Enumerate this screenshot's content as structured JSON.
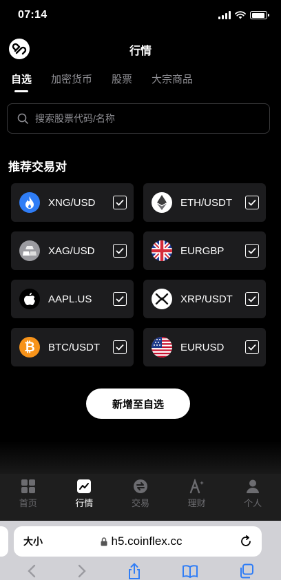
{
  "status_bar": {
    "time": "07:14",
    "battery_level": 0.9
  },
  "header": {
    "title": "行情",
    "logo_icon": "coinflex-logo"
  },
  "tabs": [
    {
      "label": "自选",
      "active": true
    },
    {
      "label": "加密货币",
      "active": false
    },
    {
      "label": "股票",
      "active": false
    },
    {
      "label": "大宗商品",
      "active": false
    }
  ],
  "search": {
    "placeholder": "搜索股票代码/名称"
  },
  "section": {
    "title": "推荐交易对"
  },
  "pairs": [
    {
      "label": "XNG/USD",
      "icon": "flame-icon",
      "checked": true
    },
    {
      "label": "ETH/USDT",
      "icon": "ethereum-icon",
      "checked": true
    },
    {
      "label": "XAG/USD",
      "icon": "silver-bars-icon",
      "checked": true
    },
    {
      "label": "EURGBP",
      "icon": "uk-flag-icon",
      "checked": true
    },
    {
      "label": "AAPL.US",
      "icon": "apple-icon",
      "checked": true
    },
    {
      "label": "XRP/USDT",
      "icon": "xrp-icon",
      "checked": true
    },
    {
      "label": "BTC/USDT",
      "icon": "bitcoin-icon",
      "checked": true
    },
    {
      "label": "EURUSD",
      "icon": "us-flag-icon",
      "checked": true
    }
  ],
  "add_button": {
    "label": "新增至自选"
  },
  "tabbar": [
    {
      "label": "首页",
      "icon": "home-grid-icon",
      "active": false
    },
    {
      "label": "行情",
      "icon": "market-chart-icon",
      "active": true
    },
    {
      "label": "交易",
      "icon": "exchange-icon",
      "active": false
    },
    {
      "label": "理财",
      "icon": "finance-icon",
      "active": false
    },
    {
      "label": "个人",
      "icon": "person-icon",
      "active": false
    }
  ],
  "browser": {
    "text_size": "大小",
    "url": "h5.coinflex.cc"
  },
  "colors": {
    "background": "#000000",
    "card": "#1c1c1e",
    "accent": "#ffffff",
    "muted": "#8e8e93"
  }
}
